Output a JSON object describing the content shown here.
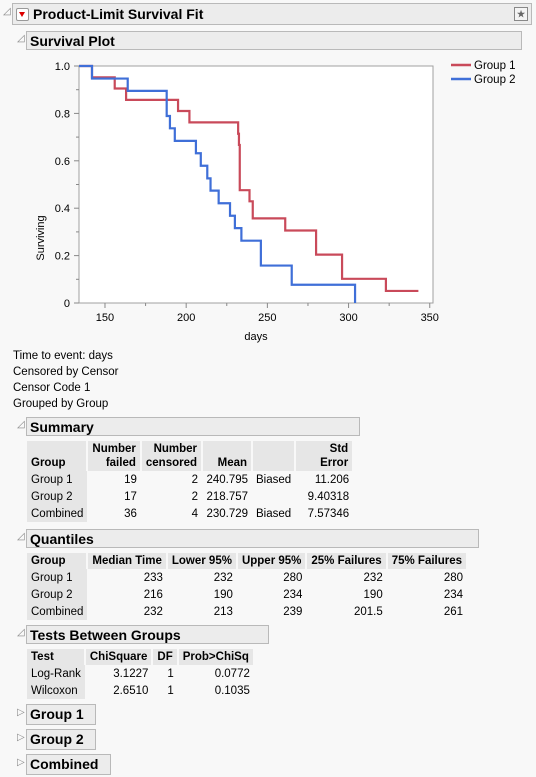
{
  "report": {
    "title": "Product-Limit Survival Fit",
    "plot_section": "Survival Plot",
    "info": [
      "Time to event:  days",
      "Censored by  Censor",
      "Censor Code  1",
      "Grouped by  Group"
    ]
  },
  "chart_data": {
    "type": "line",
    "title": "Survival Plot",
    "xlabel": "days",
    "ylabel": "Surviving",
    "xlim": [
      134,
      352
    ],
    "ylim": [
      0,
      1.0
    ],
    "xticks": [
      150,
      200,
      250,
      300,
      350
    ],
    "yticks": [
      "0",
      "0.2",
      "0.4",
      "0.6",
      "0.8",
      "1.0"
    ],
    "yticks_values": [
      0,
      0.2,
      0.4,
      0.6,
      0.8,
      1.0
    ],
    "legend_position": "top-right",
    "series": [
      {
        "name": "Group 1",
        "color": "#c94a5a",
        "steps": [
          [
            134,
            1.0
          ],
          [
            142,
            0.952
          ],
          [
            156,
            0.905
          ],
          [
            163,
            0.857
          ],
          [
            195,
            0.81
          ],
          [
            202,
            0.762
          ],
          [
            232,
            0.714
          ],
          [
            232.5,
            0.667
          ],
          [
            233,
            0.476
          ],
          [
            239,
            0.429
          ],
          [
            241,
            0.357
          ],
          [
            261,
            0.306
          ],
          [
            280,
            0.204
          ],
          [
            296,
            0.102
          ],
          [
            323,
            0.051
          ]
        ],
        "end": 343
      },
      {
        "name": "Group 2",
        "color": "#3f6fd8",
        "steps": [
          [
            134,
            1.0
          ],
          [
            142,
            0.947
          ],
          [
            164,
            0.895
          ],
          [
            188,
            0.789
          ],
          [
            190,
            0.737
          ],
          [
            193,
            0.684
          ],
          [
            206,
            0.632
          ],
          [
            209,
            0.579
          ],
          [
            213,
            0.526
          ],
          [
            215,
            0.474
          ],
          [
            220,
            0.421
          ],
          [
            227,
            0.368
          ],
          [
            230,
            0.316
          ],
          [
            234,
            0.263
          ],
          [
            246,
            0.158
          ],
          [
            265,
            0.077
          ],
          [
            304,
            0.0
          ]
        ],
        "end": 304
      }
    ]
  },
  "summary": {
    "title": "Summary",
    "headers": [
      "Group",
      "Number failed",
      "Number censored",
      "Mean",
      "",
      "Std Error"
    ],
    "rows": [
      [
        "Group 1",
        "19",
        "2",
        "240.795",
        "Biased",
        "11.206"
      ],
      [
        "Group 2",
        "17",
        "2",
        "218.757",
        "",
        "9.40318"
      ],
      [
        "Combined",
        "36",
        "4",
        "230.729",
        "Biased",
        "7.57346"
      ]
    ]
  },
  "quantiles": {
    "title": "Quantiles",
    "headers": [
      "Group",
      "Median Time",
      "Lower 95%",
      "Upper 95%",
      "25% Failures",
      "75% Failures"
    ],
    "rows": [
      [
        "Group 1",
        "233",
        "232",
        "280",
        "232",
        "280"
      ],
      [
        "Group 2",
        "216",
        "190",
        "234",
        "190",
        "234"
      ],
      [
        "Combined",
        "232",
        "213",
        "239",
        "201.5",
        "261"
      ]
    ]
  },
  "tests": {
    "title": "Tests Between Groups",
    "headers": [
      "Test",
      "ChiSquare",
      "DF",
      "Prob>ChiSq"
    ],
    "rows": [
      [
        "Log-Rank",
        "3.1227",
        "1",
        "0.0772"
      ],
      [
        "Wilcoxon",
        "2.6510",
        "1",
        "0.1035"
      ]
    ]
  },
  "collapsed": [
    "Group 1",
    "Group 2",
    "Combined"
  ]
}
